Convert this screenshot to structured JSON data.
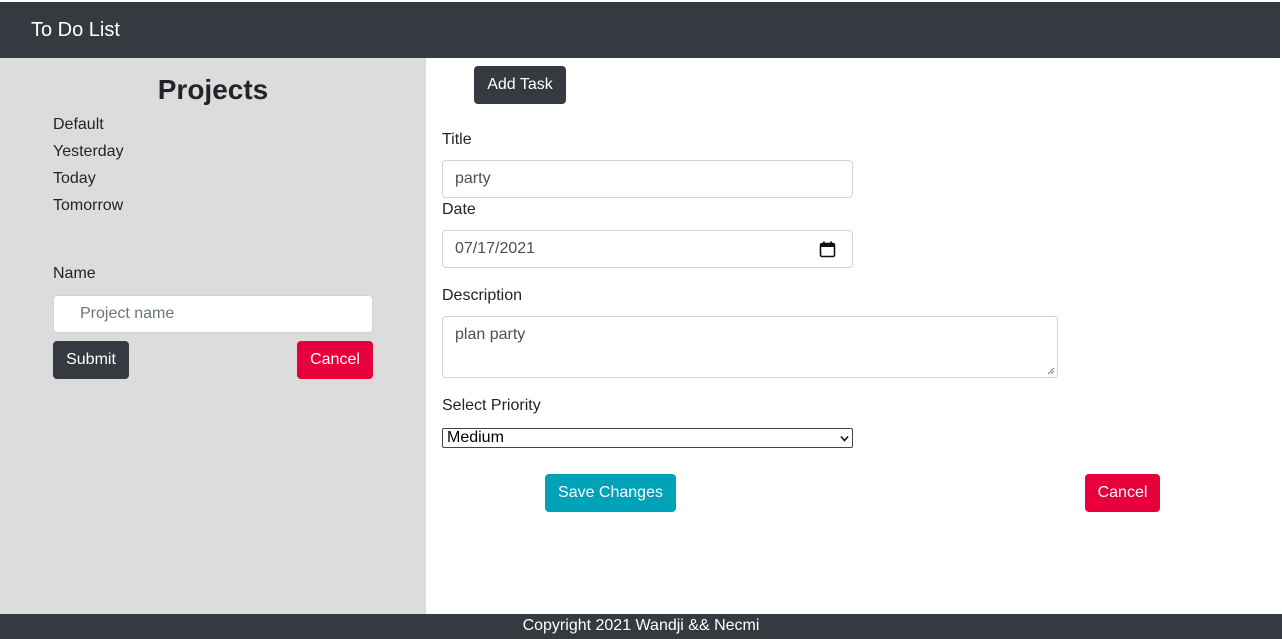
{
  "navbar": {
    "brand": "To Do List"
  },
  "sidebar": {
    "title": "Projects",
    "projects": [
      "Default",
      "Yesterday",
      "Today",
      "Tomorrow"
    ],
    "form": {
      "name_label": "Name",
      "name_placeholder": "Project name",
      "name_value": "",
      "submit_label": "Submit",
      "cancel_label": "Cancel"
    }
  },
  "main": {
    "add_task_label": "Add Task",
    "form": {
      "title_label": "Title",
      "title_value": "party",
      "date_label": "Date",
      "date_value": "07/17/2021",
      "description_label": "Description",
      "description_value": "plan party",
      "priority_label": "Select Priority",
      "priority_value": "Medium",
      "save_label": "Save Changes",
      "cancel_label": "Cancel"
    }
  },
  "footer": {
    "text": "Copyright 2021 Wandji && Necmi"
  },
  "colors": {
    "navbar_bg": "#343a40",
    "sidebar_bg": "#dcdcdc",
    "danger": "#e8003d",
    "info": "#00a2b8"
  },
  "icons": {
    "date_picker": "calendar-icon",
    "select": "chevron-down-icon"
  }
}
